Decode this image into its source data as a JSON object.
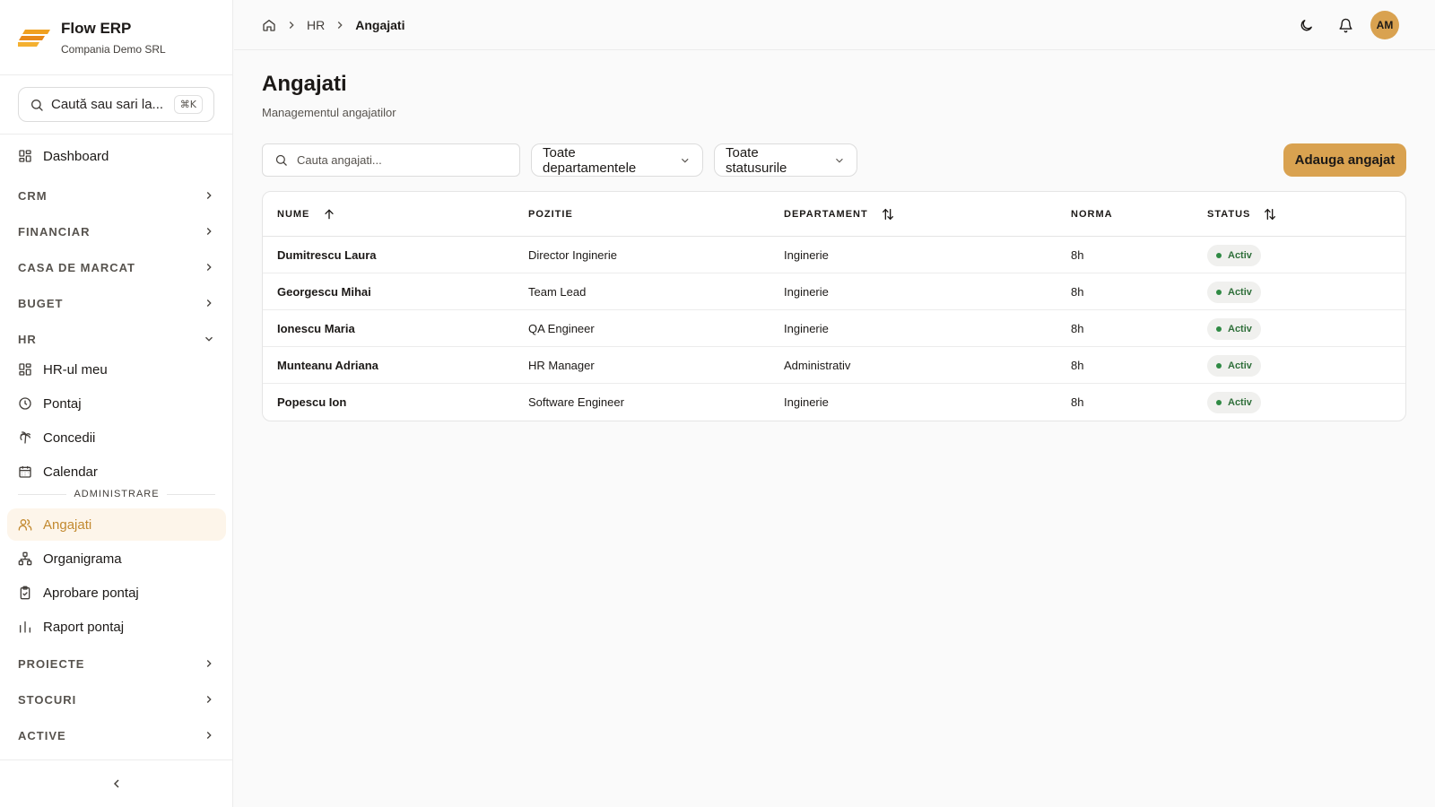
{
  "brand": {
    "name": "Flow ERP",
    "company": "Compania Demo SRL"
  },
  "sidebar_search": {
    "placeholder": "Caută sau sari la...",
    "shortcut": "⌘K"
  },
  "nav": {
    "dashboard": "Dashboard",
    "sections": {
      "crm": "CRM",
      "financiar": "FINANCIAR",
      "casa": "CASA DE MARCAT",
      "buget": "BUGET",
      "hr": "HR",
      "proiecte": "PROIECTE",
      "stocuri": "STOCURI",
      "active": "ACTIVE"
    },
    "hr_items": [
      "HR-ul meu",
      "Pontaj",
      "Concedii",
      "Calendar"
    ],
    "admin_label": "ADMINISTRARE",
    "admin_items": [
      "Angajati",
      "Organigrama",
      "Aprobare pontaj",
      "Raport pontaj"
    ]
  },
  "breadcrumb": {
    "level1": "HR",
    "current": "Angajati"
  },
  "user": {
    "initials": "AM"
  },
  "page": {
    "title": "Angajati",
    "subtitle": "Managementul angajatilor"
  },
  "filters": {
    "search_placeholder": "Cauta angajati...",
    "department": "Toate departamentele",
    "status": "Toate statusurile",
    "add_label": "Adauga angajat"
  },
  "table": {
    "columns": {
      "name": "NUME",
      "position": "POZITIE",
      "department": "DEPARTAMENT",
      "norm": "NORMA",
      "status": "STATUS"
    },
    "rows": [
      {
        "name": "Dumitrescu Laura",
        "position": "Director Inginerie",
        "department": "Inginerie",
        "norm": "8h",
        "status": "Activ"
      },
      {
        "name": "Georgescu Mihai",
        "position": "Team Lead",
        "department": "Inginerie",
        "norm": "8h",
        "status": "Activ"
      },
      {
        "name": "Ionescu Maria",
        "position": "QA Engineer",
        "department": "Inginerie",
        "norm": "8h",
        "status": "Activ"
      },
      {
        "name": "Munteanu Adriana",
        "position": "HR Manager",
        "department": "Administrativ",
        "norm": "8h",
        "status": "Activ"
      },
      {
        "name": "Popescu Ion",
        "position": "Software Engineer",
        "department": "Inginerie",
        "norm": "8h",
        "status": "Activ"
      }
    ]
  },
  "colors": {
    "accent": "#d9a250",
    "active_text": "#c2892f",
    "active_bg": "#fdf5ea",
    "status_green": "#2f6f3a"
  }
}
